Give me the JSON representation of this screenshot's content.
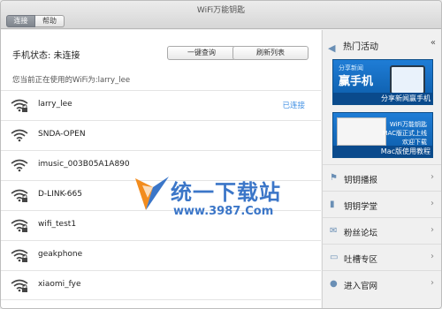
{
  "window": {
    "title": "WiFi万能钥匙"
  },
  "tabs": [
    {
      "label": "连接",
      "active": true
    },
    {
      "label": "帮助",
      "active": false
    }
  ],
  "status": {
    "label": "手机状态: 未连接"
  },
  "buttons": {
    "query": "一键查询",
    "refresh": "刷新列表"
  },
  "current_wifi": "您当前正在使用的WiFi为:larry_lee",
  "networks": [
    {
      "ssid": "larry_lee",
      "status": "已连接",
      "locked": true
    },
    {
      "ssid": "SNDA-OPEN",
      "status": "",
      "locked": false
    },
    {
      "ssid": "imusic_003B05A1A890",
      "status": "",
      "locked": false
    },
    {
      "ssid": "D-LINK-665",
      "status": "",
      "locked": true
    },
    {
      "ssid": "wifi_test1",
      "status": "",
      "locked": true
    },
    {
      "ssid": "geakphone",
      "status": "",
      "locked": true
    },
    {
      "ssid": "xiaomi_fye",
      "status": "",
      "locked": true
    }
  ],
  "sidebar": {
    "header": "热门活动",
    "banner1": {
      "small": "分享新闻",
      "big": "赢手机",
      "caption": "分享新闻赢手机"
    },
    "banner2": {
      "line1": "WiFi万能钥匙",
      "line2": "MAC版正式上线",
      "line3": "欢迎下载",
      "caption": "Mac版使用教程"
    },
    "menu": [
      {
        "label": "钥钥播报",
        "icon": "flag-icon"
      },
      {
        "label": "钥钥学堂",
        "icon": "bookmark-icon"
      },
      {
        "label": "粉丝论坛",
        "icon": "chat-icon"
      },
      {
        "label": "吐槽专区",
        "icon": "comment-icon"
      },
      {
        "label": "进入官网",
        "icon": "user-icon"
      }
    ]
  },
  "watermark": {
    "text": "统一下载站",
    "url": "www.3987.Com"
  },
  "colors": {
    "accent": "#3d8ee3",
    "banner": "#1f7dd6",
    "icon": "#6a8fb5"
  }
}
